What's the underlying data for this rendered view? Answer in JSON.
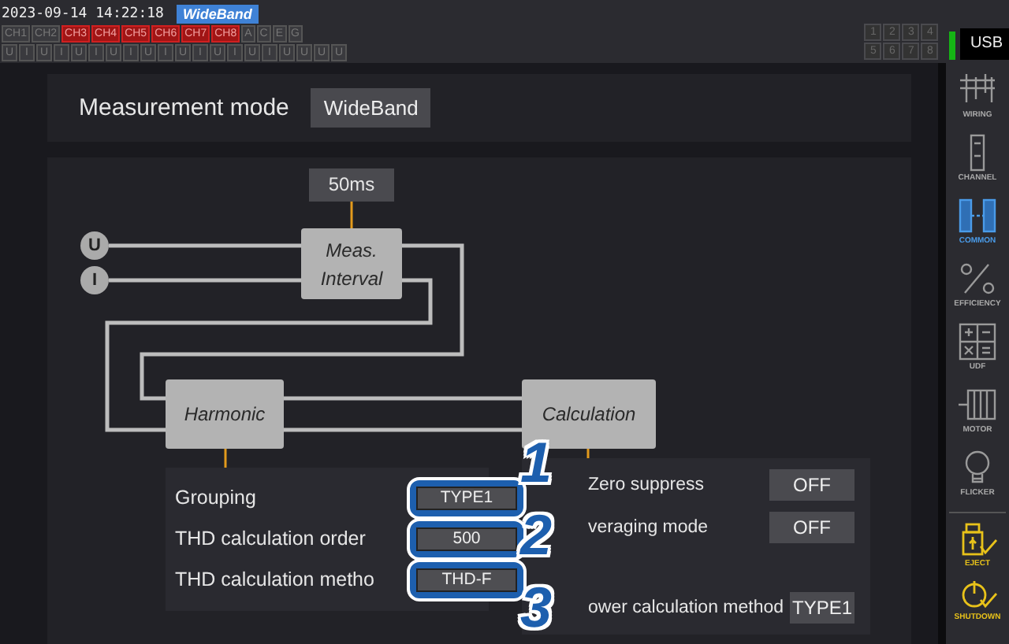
{
  "status_bar": {
    "datetime": "2023-09-14 14:22:18",
    "mode_badge": "WideBand",
    "channels": [
      {
        "label": "CH1",
        "active": false
      },
      {
        "label": "CH2",
        "active": false
      },
      {
        "label": "CH3",
        "active": true
      },
      {
        "label": "CH4",
        "active": true
      },
      {
        "label": "CH5",
        "active": true
      },
      {
        "label": "CH6",
        "active": true
      },
      {
        "label": "CH7",
        "active": true
      },
      {
        "label": "CH8",
        "active": true
      },
      {
        "label": "A",
        "active": false
      },
      {
        "label": "C",
        "active": false
      },
      {
        "label": "E",
        "active": false
      },
      {
        "label": "G",
        "active": false
      }
    ],
    "inputs": [
      "U",
      "I",
      "U",
      "I",
      "U",
      "I",
      "U",
      "I",
      "U",
      "I",
      "U",
      "I",
      "U",
      "I",
      "U",
      "I",
      "U",
      "U",
      "U",
      "U"
    ],
    "slots": [
      "1",
      "2",
      "3",
      "4",
      "5",
      "6",
      "7",
      "8"
    ],
    "usb": {
      "label": "USB",
      "connected": true
    }
  },
  "measurement_mode": {
    "label": "Measurement mode",
    "value": "WideBand"
  },
  "diagram": {
    "interval": "50ms",
    "inputs": [
      "U",
      "I"
    ],
    "interval_node": "Meas. Interval",
    "harmonic_node": "Harmonic",
    "calculation_node": "Calculation"
  },
  "harmonic_settings": [
    {
      "label": "Grouping",
      "value": "TYPE1",
      "callout": "1"
    },
    {
      "label": "THD calculation order",
      "value": "500",
      "callout": "2"
    },
    {
      "label": "THD calculation metho",
      "value": "THD-F",
      "callout": "3"
    }
  ],
  "calculation_settings": [
    {
      "label": "Zero suppress",
      "value": "OFF"
    },
    {
      "label": "veraging mode",
      "value": "OFF"
    },
    {
      "label": "ower calculation method",
      "value": "TYPE1"
    }
  ],
  "sidebar": [
    {
      "label": "WIRING",
      "selected": false
    },
    {
      "label": "CHANNEL",
      "selected": false
    },
    {
      "label": "COMMON",
      "selected": true
    },
    {
      "label": "EFFICIENCY",
      "selected": false
    },
    {
      "label": "UDF",
      "selected": false
    },
    {
      "label": "MOTOR",
      "selected": false
    },
    {
      "label": "FLICKER",
      "selected": false
    }
  ],
  "actions": [
    {
      "label": "EJECT"
    },
    {
      "label": "SHUTDOWN"
    }
  ]
}
